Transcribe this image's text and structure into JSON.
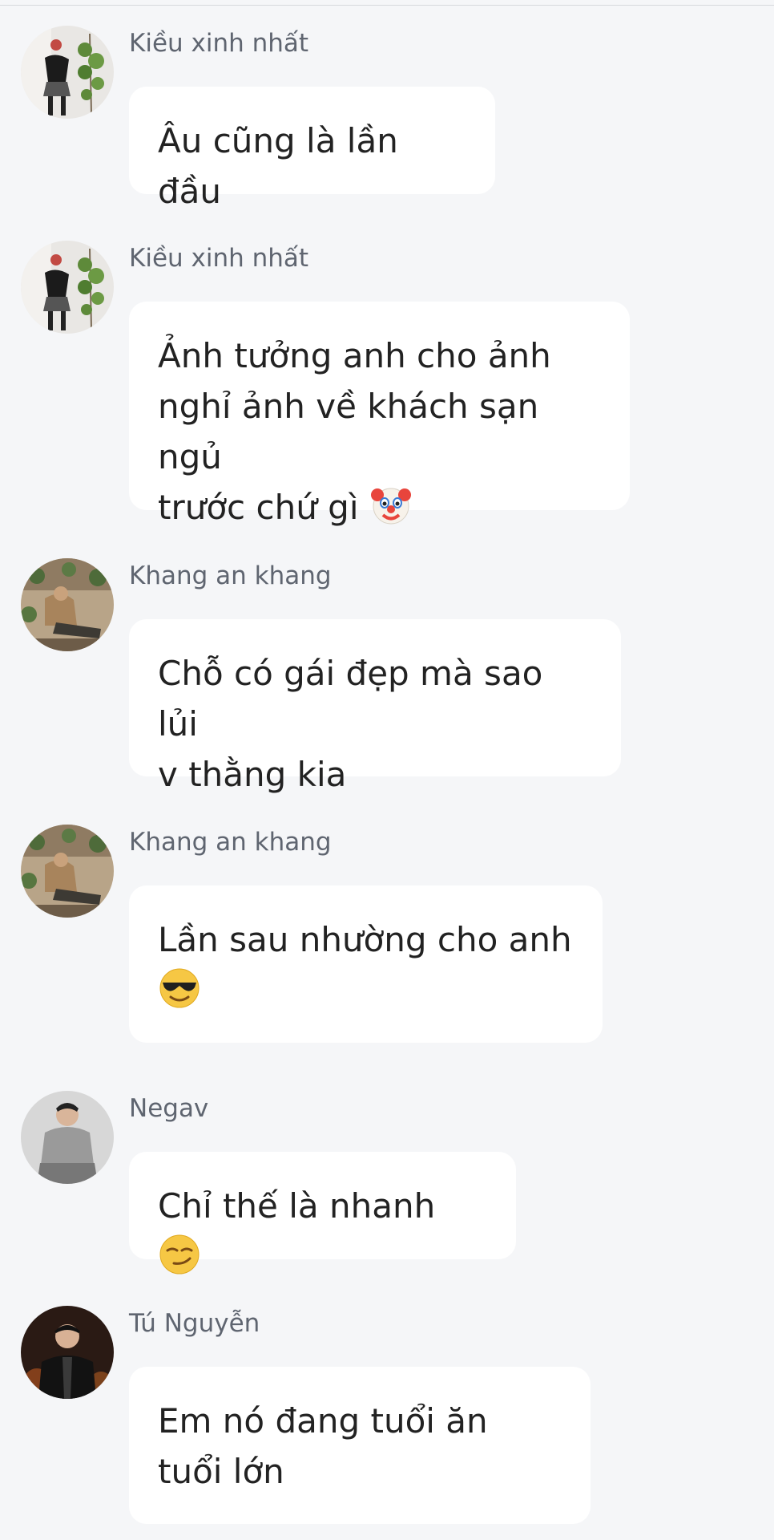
{
  "messages": [
    {
      "sender": "Kiều xinh nhất",
      "avatar": "avatar-kieu-icon",
      "lines": [
        "Âu cũng là lần đầu"
      ],
      "emoji": null
    },
    {
      "sender": "Kiều xinh nhất",
      "avatar": "avatar-kieu-icon",
      "lines": [
        "Ảnh tưởng anh cho ảnh",
        "nghỉ ảnh về khách sạn ngủ",
        "trước chứ gì"
      ],
      "emoji": "clown-face-emoji"
    },
    {
      "sender": "Khang an khang",
      "avatar": "avatar-khang-icon",
      "lines": [
        "Chỗ có gái đẹp mà sao lủi",
        "v thằng kia"
      ],
      "emoji": null
    },
    {
      "sender": "Khang an khang",
      "avatar": "avatar-khang-icon",
      "lines": [
        "Lần sau nhường cho anh"
      ],
      "emoji": "sunglasses-emoji"
    },
    {
      "sender": "Negav",
      "avatar": "avatar-negav-icon",
      "lines": [
        "Chỉ thế là nhanh"
      ],
      "emoji": "smirking-face-emoji"
    },
    {
      "sender": "Tú Nguyễn",
      "avatar": "avatar-tu-icon",
      "lines": [
        "Em nó đang tuổi ăn",
        "tuổi lớn"
      ],
      "emoji": null
    }
  ],
  "colors": {
    "background": "#f5f6f8",
    "bubble": "#ffffff",
    "sender_text": "#5f6570",
    "message_text": "#222222"
  }
}
